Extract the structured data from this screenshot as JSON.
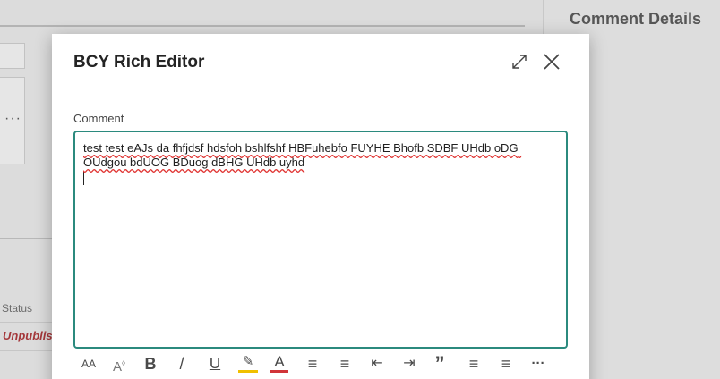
{
  "background": {
    "status_header": "Status",
    "status_value": "Unpublis",
    "more_glyph": "···",
    "side_panel_title": "Comment Details"
  },
  "dialog": {
    "title": "BCY Rich Editor",
    "field_label": "Comment",
    "comment_text": "test test eAJs da fhfjdsf hdsfoh bshlfshf HBFuhebfo FUYHE Bhofb SDBF UHdb oDG OUdgou bdUOG BDuog dBHG UHdb uyhd",
    "accent_color": "#2b8a7e"
  },
  "toolbar": {
    "font_size": "AA",
    "font_style": "A",
    "bold": "B",
    "italic": "/",
    "underline": "U",
    "highlight": "✎",
    "font_color": "A",
    "bullets": "≡",
    "numbering": "≡",
    "outdent": "⇤",
    "indent": "⇥",
    "quote": "”",
    "align_left": "≡",
    "align_center": "≡",
    "more": "···"
  }
}
